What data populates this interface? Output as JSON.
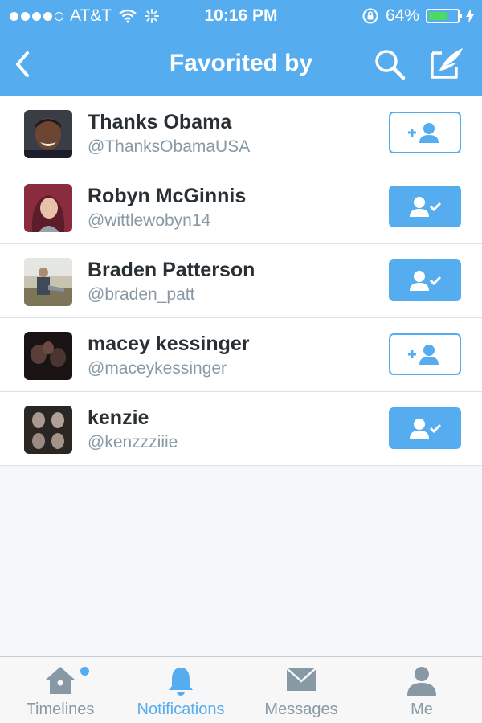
{
  "status_bar": {
    "carrier": "AT&T",
    "time": "10:16 PM",
    "battery_percent": "64%",
    "battery_level": 0.64,
    "signal_bars": 4,
    "icons": [
      "wifi-icon",
      "activity-spinner-icon",
      "orientation-lock-icon",
      "charging-bolt-icon"
    ]
  },
  "nav": {
    "title": "Favorited by",
    "icons": [
      "back-chevron-icon",
      "search-icon",
      "compose-tweet-icon"
    ]
  },
  "users": [
    {
      "name": "Thanks Obama",
      "handle": "@ThanksObamaUSA",
      "following": false
    },
    {
      "name": "Robyn McGinnis",
      "handle": "@wittlewobyn14",
      "following": true
    },
    {
      "name": "Braden Patterson",
      "handle": "@braden_patt",
      "following": true
    },
    {
      "name": "macey kessinger",
      "handle": "@maceykessinger",
      "following": false
    },
    {
      "name": "kenzie",
      "handle": "@kenzzziiie",
      "following": true
    }
  ],
  "tabs": [
    {
      "label": "Timelines",
      "icon": "home-icon",
      "unread": true
    },
    {
      "label": "Notifications",
      "icon": "bell-icon",
      "active": true
    },
    {
      "label": "Messages",
      "icon": "envelope-icon"
    },
    {
      "label": "Me",
      "icon": "person-icon"
    }
  ],
  "colors": {
    "brand": "#55acee",
    "text_primary": "#292f33",
    "text_secondary": "#8899a6",
    "battery_fill": "#4cd964"
  }
}
